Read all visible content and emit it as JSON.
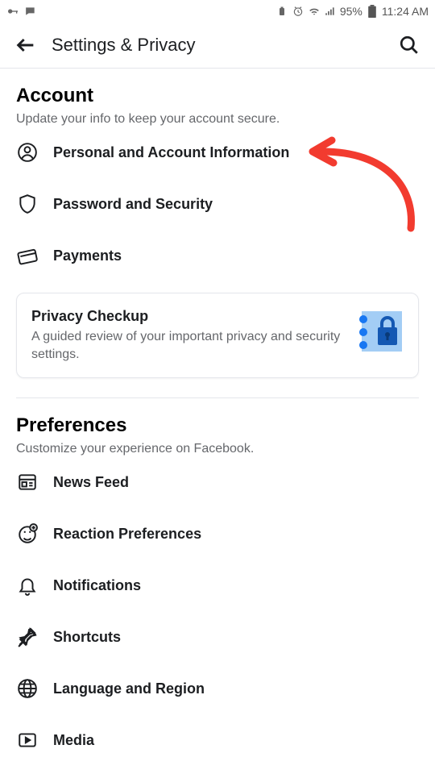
{
  "status_bar": {
    "battery_pct": "95%",
    "time": "11:24 AM"
  },
  "header": {
    "title": "Settings & Privacy"
  },
  "sections": {
    "account": {
      "title": "Account",
      "subtitle": "Update your info to keep your account secure.",
      "items": [
        {
          "icon": "person-circle-icon",
          "label": "Personal and Account Information"
        },
        {
          "icon": "shield-icon",
          "label": "Password and Security"
        },
        {
          "icon": "card-icon",
          "label": "Payments"
        }
      ],
      "card": {
        "title": "Privacy Checkup",
        "subtitle": "A guided review of your important privacy and security settings."
      }
    },
    "preferences": {
      "title": "Preferences",
      "subtitle": "Customize your experience on Facebook.",
      "items": [
        {
          "icon": "news-feed-icon",
          "label": "News Feed"
        },
        {
          "icon": "reaction-icon",
          "label": "Reaction Preferences"
        },
        {
          "icon": "bell-icon",
          "label": "Notifications"
        },
        {
          "icon": "pin-icon",
          "label": "Shortcuts"
        },
        {
          "icon": "globe-icon",
          "label": "Language and Region"
        },
        {
          "icon": "media-icon",
          "label": "Media"
        }
      ]
    }
  }
}
